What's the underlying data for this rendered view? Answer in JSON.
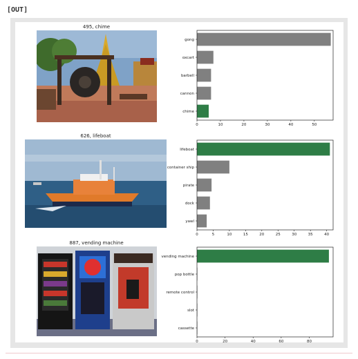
{
  "cell_label": "[OUT]",
  "chart_data": [
    {
      "type": "bar",
      "orientation": "horizontal",
      "image_title": "495, chime",
      "categories": [
        "gong",
        "oxcart",
        "barbell",
        "cannon",
        "chime"
      ],
      "values": [
        57,
        7,
        6,
        6,
        5
      ],
      "xlim": [
        0,
        58
      ],
      "xticks": [
        0,
        10,
        20,
        30,
        40,
        50
      ],
      "highlight": "chime",
      "grid": false
    },
    {
      "type": "bar",
      "orientation": "horizontal",
      "image_title": "626, lifeboat",
      "categories": [
        "lifeboat",
        "container ship",
        "pirate",
        "dock",
        "yawl"
      ],
      "values": [
        41,
        10,
        4.5,
        4,
        3
      ],
      "xlim": [
        0,
        42
      ],
      "xticks": [
        0,
        5,
        10,
        15,
        20,
        25,
        30,
        35,
        40
      ],
      "highlight": "lifeboat",
      "grid": false
    },
    {
      "type": "bar",
      "orientation": "horizontal",
      "image_title": "887, vending machine",
      "categories": [
        "vending machine",
        "pop bottle",
        "remote control",
        "slot",
        "cassette"
      ],
      "values": [
        94,
        0.3,
        0.2,
        0.1,
        0.1
      ],
      "xlim": [
        0,
        97
      ],
      "xticks": [
        0,
        20,
        40,
        60,
        80
      ],
      "highlight": "vending machine",
      "grid": false
    }
  ],
  "colors": {
    "bar": "#808080",
    "highlight": "#2e7d46",
    "frame": "#e6e6e6"
  }
}
